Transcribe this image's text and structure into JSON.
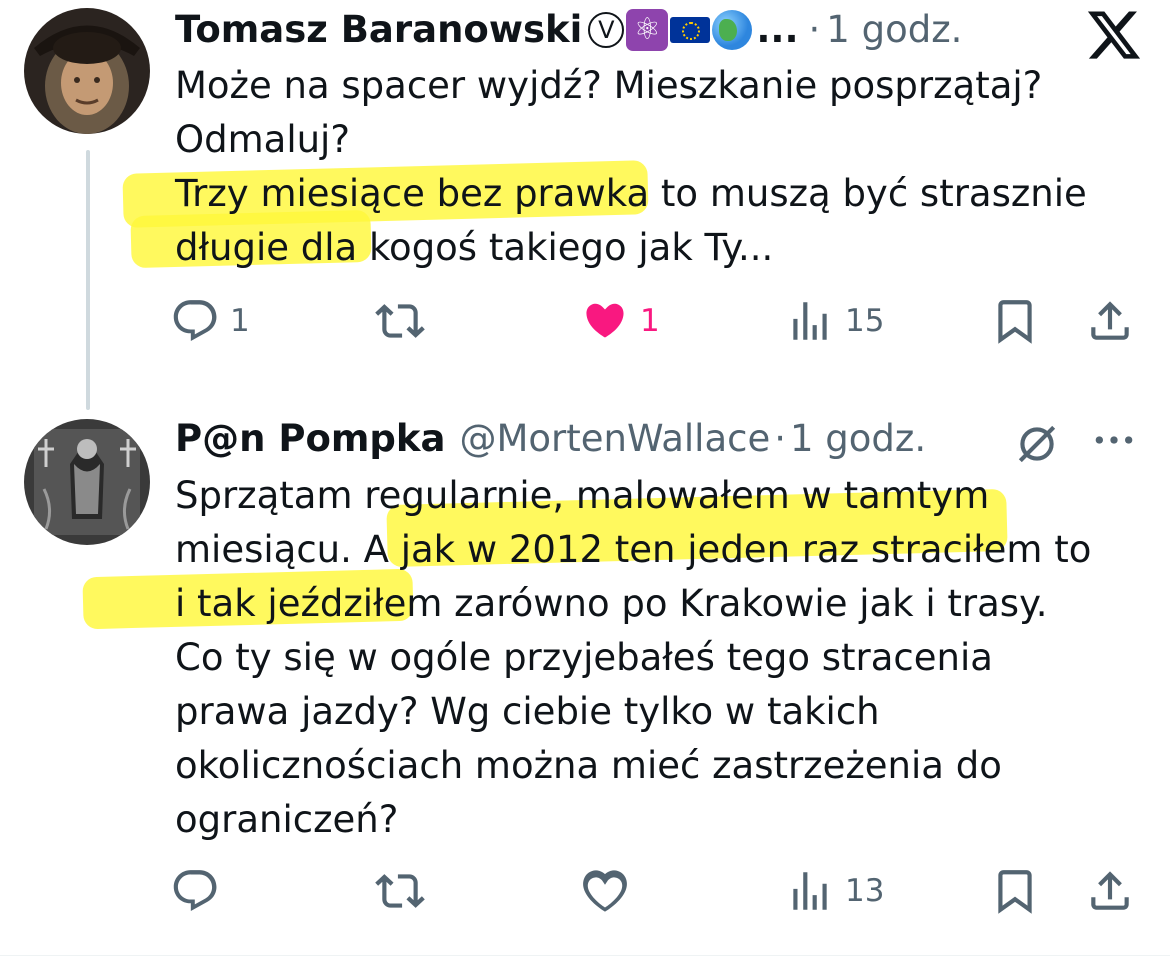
{
  "tweets": [
    {
      "author_name": "Tomasz Baranowski",
      "badge_v": "V",
      "badge_atom": "⚛",
      "name_truncation": "...",
      "dot": "·",
      "time": "1 godz.",
      "lines": [
        "Może na spacer wyjdź? Mieszkanie posprzątaj?",
        "Odmaluj?",
        "Trzy miesiące bez prawka to muszą być strasznie",
        "długie dla kogoś takiego jak Ty..."
      ],
      "metrics": {
        "replies": "1",
        "reposts": "",
        "likes": "1",
        "views": "15"
      }
    },
    {
      "author_name": "P@n Pompka",
      "handle": "@MortenWallace",
      "dot": "·",
      "time": "1 godz.",
      "lines": [
        "Sprzątam regularnie, malowałem w tamtym",
        "miesiącu. A jak w 2012 ten jeden raz straciłem to",
        "i tak jeździłem zarówno po Krakowie jak i trasy.",
        "Co ty się w ogóle przyjebałeś tego stracenia",
        "prawa jazdy? Wg ciebie tylko w takich",
        "okolicznościach można mieć zastrzeżenia do",
        "ograniczeń?"
      ],
      "metrics": {
        "replies": "",
        "reposts": "",
        "likes": "",
        "views": "13"
      }
    }
  ],
  "colors": {
    "highlight": "#fff83a",
    "like_active": "#f91880",
    "icon_gray": "#536471",
    "text": "#0f1419",
    "thread_line": "#cfd9de"
  },
  "icons": [
    "x-logo-icon",
    "reply-icon",
    "repost-icon",
    "heart-icon",
    "views-icon",
    "bookmark-icon",
    "share-icon",
    "grok-icon",
    "more-icon"
  ]
}
